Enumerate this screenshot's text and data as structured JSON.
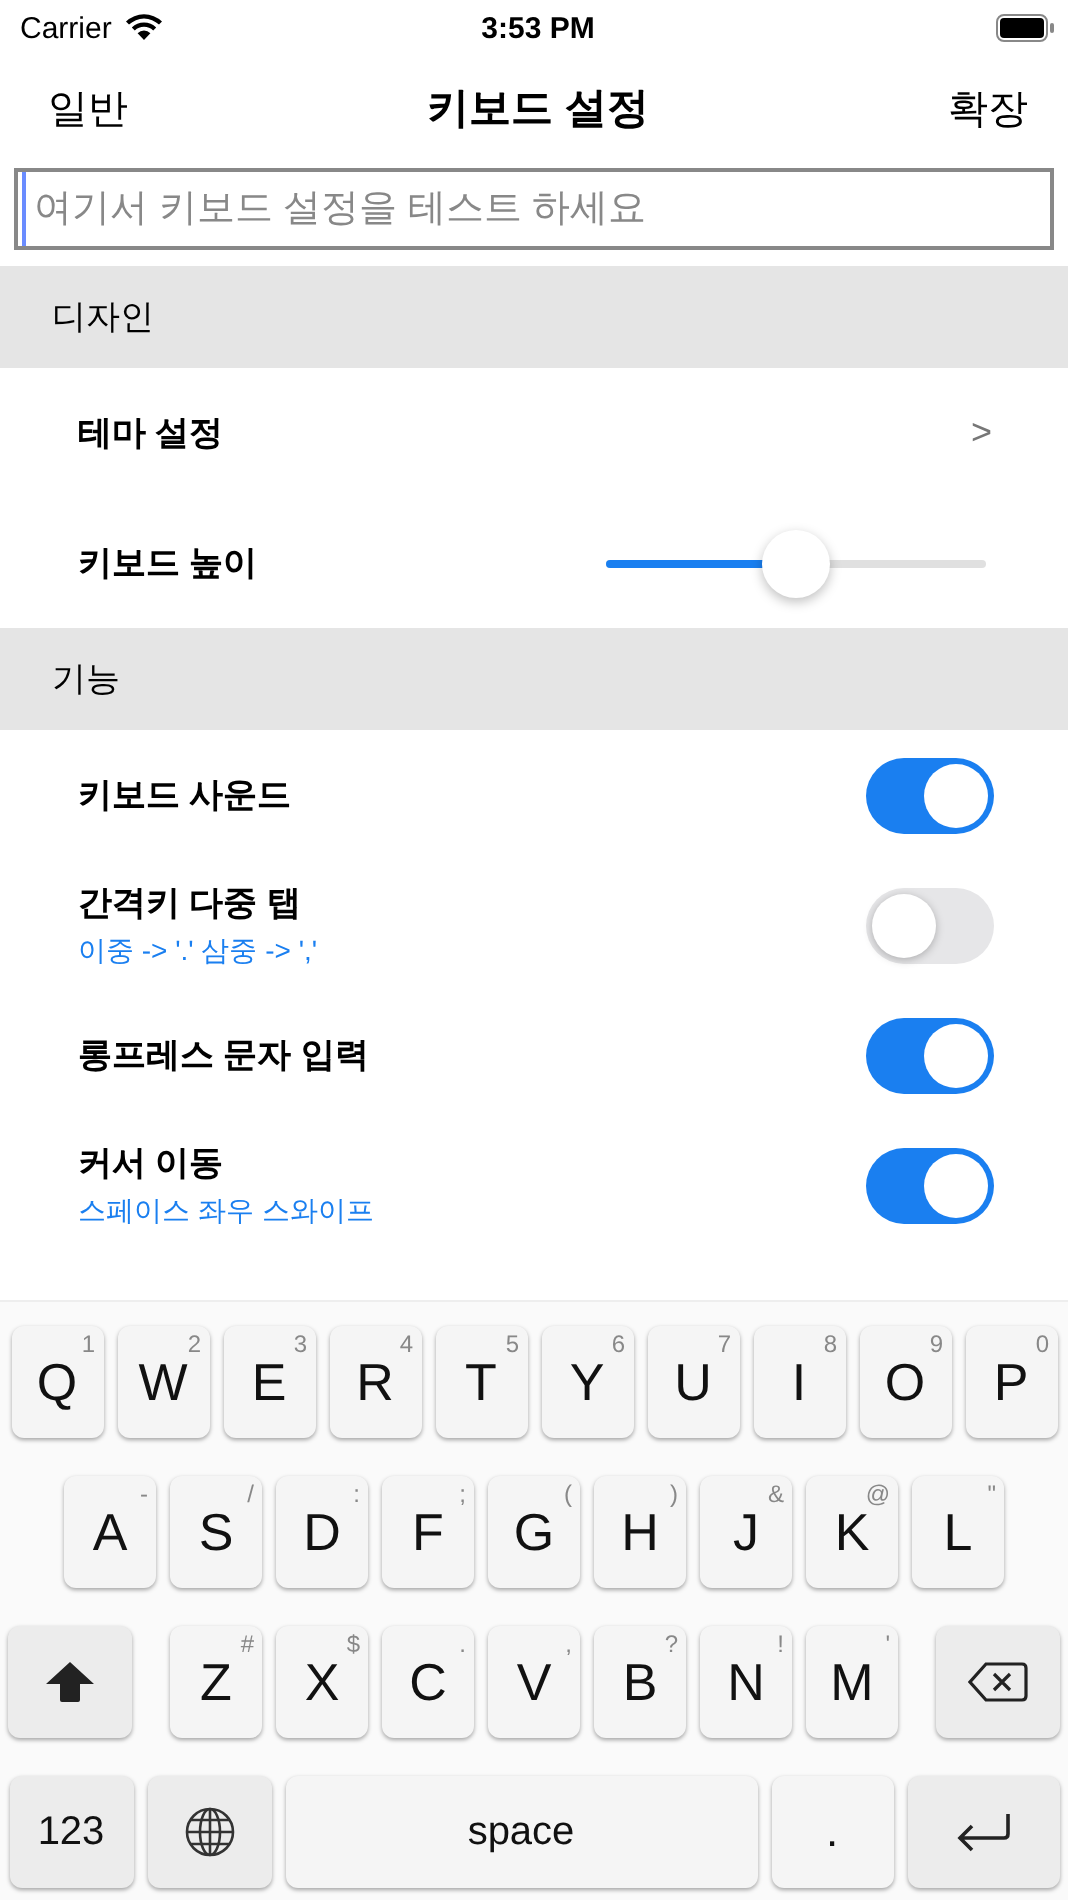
{
  "status_bar": {
    "carrier": "Carrier",
    "time": "3:53 PM"
  },
  "nav": {
    "left": "일반",
    "title": "키보드 설정",
    "right": "확장"
  },
  "search": {
    "placeholder": "여기서 키보드 설정을 테스트 하세요"
  },
  "sections": [
    {
      "title": "디자인",
      "rows": [
        {
          "kind": "link",
          "label": "테마 설정",
          "chevron": ">"
        },
        {
          "kind": "slider",
          "label": "키보드 높이",
          "level": 0.5
        }
      ]
    },
    {
      "title": "기능",
      "rows": [
        {
          "kind": "toggle",
          "label": "키보드 사운드",
          "on": true
        },
        {
          "kind": "toggle",
          "label": "간격키 다중 탭",
          "subtitle": "이중 -> '.' 삼중 -> ','",
          "on": false
        },
        {
          "kind": "toggle",
          "label": "롱프레스 문자 입력",
          "on": true
        },
        {
          "kind": "toggle",
          "label": "커서 이동",
          "subtitle": "스페이스 좌우 스와이프",
          "on": true
        }
      ]
    }
  ],
  "keyboard": [
    [
      {
        "kind": "letter",
        "label": "Q",
        "hint": "1"
      },
      {
        "kind": "letter",
        "label": "W",
        "hint": "2"
      },
      {
        "kind": "letter",
        "label": "E",
        "hint": "3"
      },
      {
        "kind": "letter",
        "label": "R",
        "hint": "4"
      },
      {
        "kind": "letter",
        "label": "T",
        "hint": "5"
      },
      {
        "kind": "letter",
        "label": "Y",
        "hint": "6"
      },
      {
        "kind": "letter",
        "label": "U",
        "hint": "7"
      },
      {
        "kind": "letter",
        "label": "I",
        "hint": "8"
      },
      {
        "kind": "letter",
        "label": "O",
        "hint": "9"
      },
      {
        "kind": "letter",
        "label": "P",
        "hint": "0"
      }
    ],
    [
      {
        "kind": "letter",
        "label": "A",
        "hint": "-"
      },
      {
        "kind": "letter",
        "label": "S",
        "hint": "/"
      },
      {
        "kind": "letter",
        "label": "D",
        "hint": ":"
      },
      {
        "kind": "letter",
        "label": "F",
        "hint": ";"
      },
      {
        "kind": "letter",
        "label": "G",
        "hint": "("
      },
      {
        "kind": "letter",
        "label": "H",
        "hint": ")"
      },
      {
        "kind": "letter",
        "label": "J",
        "hint": "&"
      },
      {
        "kind": "letter",
        "label": "K",
        "hint": "@"
      },
      {
        "kind": "letter",
        "label": "L",
        "hint": "\""
      }
    ],
    [
      {
        "kind": "shift"
      },
      {
        "kind": "letter",
        "label": "Z",
        "hint": "#"
      },
      {
        "kind": "letter",
        "label": "X",
        "hint": "$"
      },
      {
        "kind": "letter",
        "label": "C",
        "hint": "."
      },
      {
        "kind": "letter",
        "label": "V",
        "hint": ","
      },
      {
        "kind": "letter",
        "label": "B",
        "hint": "?"
      },
      {
        "kind": "letter",
        "label": "N",
        "hint": "!"
      },
      {
        "kind": "letter",
        "label": "M",
        "hint": "'"
      },
      {
        "kind": "delete"
      }
    ],
    [
      {
        "kind": "mode",
        "label": "123"
      },
      {
        "kind": "globe"
      },
      {
        "kind": "space",
        "label": "space"
      },
      {
        "kind": "period",
        "label": "."
      },
      {
        "kind": "return"
      }
    ]
  ]
}
